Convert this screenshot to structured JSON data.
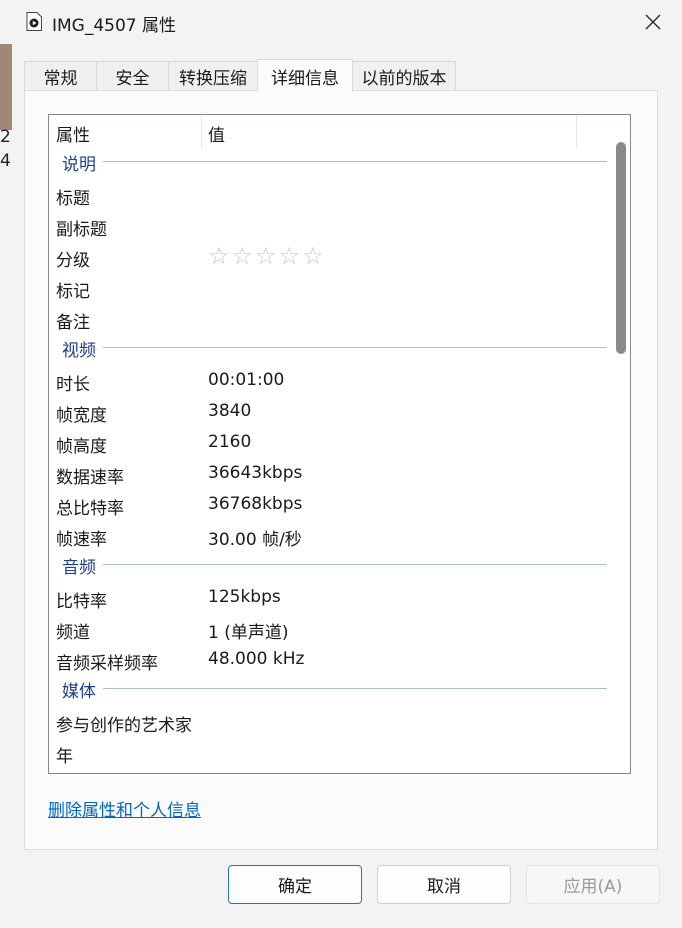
{
  "background": {
    "line1": "2",
    "line2": "4"
  },
  "window": {
    "title": "IMG_4507 属性",
    "icon": "video-file-icon",
    "close_icon": "close-icon"
  },
  "tabs": [
    {
      "label": "常规"
    },
    {
      "label": "安全"
    },
    {
      "label": "转换压缩"
    },
    {
      "label": "详细信息"
    },
    {
      "label": "以前的版本"
    }
  ],
  "active_tab": "详细信息",
  "list": {
    "col_property": "属性",
    "col_value": "值",
    "groups": {
      "description": {
        "label": "说明",
        "title": "标题",
        "subtitle": "副标题",
        "rating": "分级",
        "rating_stars": "☆☆☆☆☆",
        "rating_value": 0,
        "tags": "标记",
        "comments": "备注"
      },
      "video": {
        "label": "视频",
        "length": {
          "k": "时长",
          "v": "00:01:00"
        },
        "frame_width": {
          "k": "帧宽度",
          "v": "3840"
        },
        "frame_height": {
          "k": "帧高度",
          "v": "2160"
        },
        "data_rate": {
          "k": "数据速率",
          "v": "36643kbps"
        },
        "total_bitrate": {
          "k": "总比特率",
          "v": "36768kbps"
        },
        "frame_rate": {
          "k": "帧速率",
          "v": "30.00 帧/秒"
        }
      },
      "audio": {
        "label": "音频",
        "bitrate": {
          "k": "比特率",
          "v": "125kbps"
        },
        "channels": {
          "k": "频道",
          "v": "1 (单声道)"
        },
        "sample_rate": {
          "k": "音频采样频率",
          "v": "48.000 kHz"
        }
      },
      "media": {
        "label": "媒体",
        "contributing_artists": "参与创作的艺术家",
        "year": "年"
      }
    }
  },
  "remove_link": "删除属性和个人信息",
  "buttons": {
    "ok": "确定",
    "cancel": "取消",
    "apply": "应用(A)"
  },
  "colors": {
    "accent": "#2b6fc6",
    "group_label": "#1e3f8a",
    "link": "#0066cc"
  }
}
